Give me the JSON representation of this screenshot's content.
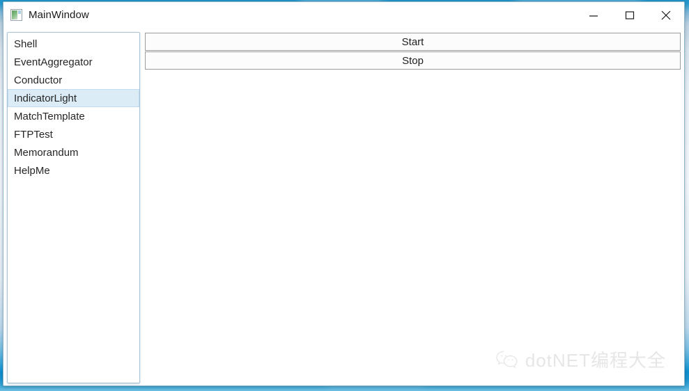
{
  "window": {
    "title": "MainWindow",
    "icon": "app-window-icon",
    "controls": [
      {
        "name": "minimize-button",
        "glyph": "minimize-icon",
        "label": "Minimize"
      },
      {
        "name": "maximize-button",
        "glyph": "maximize-icon",
        "label": "Maximize"
      },
      {
        "name": "close-button",
        "glyph": "close-icon",
        "label": "Close"
      }
    ]
  },
  "sidebar": {
    "selected_index": 3,
    "items": [
      {
        "label": "Shell"
      },
      {
        "label": "EventAggregator"
      },
      {
        "label": "Conductor"
      },
      {
        "label": "IndicatorLight"
      },
      {
        "label": "MatchTemplate"
      },
      {
        "label": "FTPTest"
      },
      {
        "label": "Memorandum"
      },
      {
        "label": "HelpMe"
      }
    ]
  },
  "content": {
    "buttons": [
      {
        "label": "Start"
      },
      {
        "label": "Stop"
      }
    ]
  },
  "watermark": {
    "text": "dotNET编程大全",
    "icon": "wechat-icon"
  },
  "colors": {
    "window_border": "#8fb8cf",
    "listbox_border": "#a9c3d6",
    "selection_background": "#dcecf7",
    "selection_border": "#c3dcef",
    "button_border": "#9b9b9b",
    "button_background": "#fcfcfc",
    "text": "#262626",
    "watermark_text": "#d2d2d2",
    "desktop_accent": "#1f93c9"
  }
}
